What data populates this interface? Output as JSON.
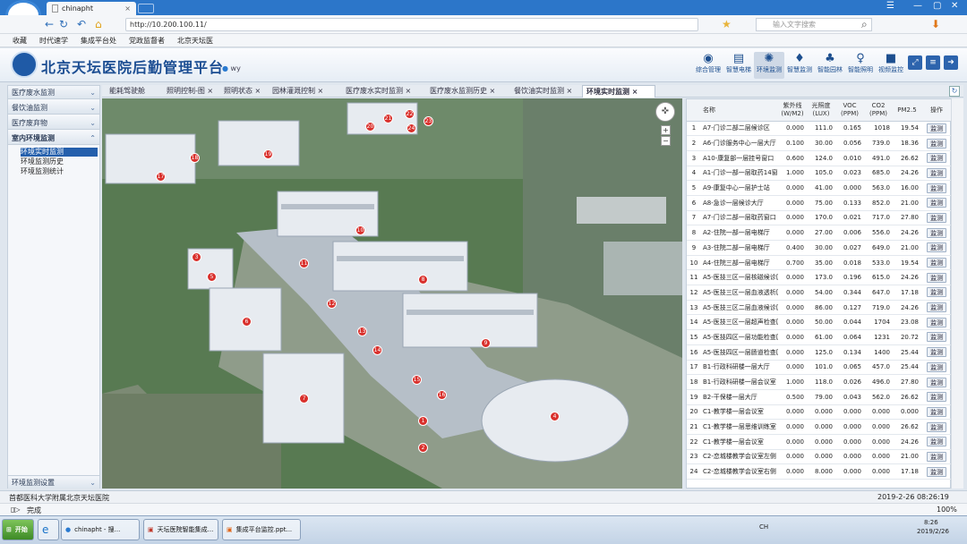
{
  "browser": {
    "tab_title": "chinapht",
    "tab_close": "×",
    "url": "http://10.200.100.11/",
    "search_placeholder": "输入文字搜索",
    "bookmarks": [
      "收藏",
      "时代速学",
      "集成平台处",
      "党政监督者",
      "北京天坛医"
    ],
    "status": "完成",
    "zoom": "100%"
  },
  "app": {
    "title": "北京天坛医院后勤管理平台",
    "user": "wy",
    "nav": [
      {
        "label": "综合管理",
        "icon": "eye-icon",
        "glyph": "◉"
      },
      {
        "label": "智慧电梯",
        "icon": "elevator-icon",
        "glyph": "▤"
      },
      {
        "label": "环境监测",
        "icon": "environment-icon",
        "glyph": "✺"
      },
      {
        "label": "智慧监测",
        "icon": "drop-icon",
        "glyph": "♦"
      },
      {
        "label": "智能园林",
        "icon": "tree-icon",
        "glyph": "♣"
      },
      {
        "label": "智能照明",
        "icon": "bulb-icon",
        "glyph": "♀"
      },
      {
        "label": "视频监控",
        "icon": "camera-icon",
        "glyph": "■"
      }
    ],
    "active_nav": 2
  },
  "sidebar": {
    "groups": [
      {
        "label": "医疗废水监测"
      },
      {
        "label": "餐饮油监测"
      },
      {
        "label": "医疗废弃物"
      },
      {
        "label": "室内环境监测"
      }
    ],
    "subitems": [
      "环境实时监测",
      "环境监测历史",
      "环境监测统计"
    ],
    "selected_sub": 0,
    "bottom": "环境监测设置"
  },
  "tabs": [
    "能耗驾驶舱",
    "照明控制-图 ×",
    "照明状态 ×",
    "园林灌溉控制 ×",
    "医疗废水实时监测 ×",
    "医疗废水监测历史 ×",
    "餐饮油实时监测 ×",
    "环境实时监测 ×"
  ],
  "active_tab": 7,
  "map_markers": [
    "1",
    "2",
    "3",
    "4",
    "5",
    "6",
    "7",
    "8",
    "9",
    "10",
    "11",
    "12",
    "13",
    "14",
    "15",
    "16",
    "17",
    "18",
    "19",
    "20",
    "21",
    "22",
    "23",
    "24"
  ],
  "table": {
    "headers": [
      "名称",
      "紫外线\n(W/M2)",
      "光照度\n(LUX)",
      "VOC\n(PPM)",
      "CO2\n(PPM)",
      "PM2.5",
      "操作"
    ],
    "action_label": "监测",
    "rows": [
      {
        "no": "1",
        "name": "A7-门诊二部二层候诊区",
        "uv": "0.000",
        "lux": "111.0",
        "voc": "0.165",
        "co2": "1018",
        "pm": "19.54"
      },
      {
        "no": "2",
        "name": "A6-门诊服务中心一层大厅",
        "uv": "0.100",
        "lux": "30.00",
        "voc": "0.056",
        "co2": "739.0",
        "pm": "18.36"
      },
      {
        "no": "3",
        "name": "A10-康复部一层挂号窗口",
        "uv": "0.600",
        "lux": "124.0",
        "voc": "0.010",
        "co2": "491.0",
        "pm": "26.62"
      },
      {
        "no": "4",
        "name": "A1-门诊一部一层取药14窗口",
        "uv": "1.000",
        "lux": "105.0",
        "voc": "0.023",
        "co2": "685.0",
        "pm": "24.26"
      },
      {
        "no": "5",
        "name": "A9-康复中心一层护士站",
        "uv": "0.000",
        "lux": "41.00",
        "voc": "0.000",
        "co2": "563.0",
        "pm": "16.00"
      },
      {
        "no": "6",
        "name": "A8-急诊一层候诊大厅",
        "uv": "0.000",
        "lux": "75.00",
        "voc": "0.133",
        "co2": "852.0",
        "pm": "21.00"
      },
      {
        "no": "7",
        "name": "A7-门诊二部一层取药窗口",
        "uv": "0.000",
        "lux": "170.0",
        "voc": "0.021",
        "co2": "717.0",
        "pm": "27.80"
      },
      {
        "no": "8",
        "name": "A2-住院一部一层电梯厅",
        "uv": "0.000",
        "lux": "27.00",
        "voc": "0.006",
        "co2": "556.0",
        "pm": "24.26"
      },
      {
        "no": "9",
        "name": "A3-住院二部一层电梯厅",
        "uv": "0.400",
        "lux": "30.00",
        "voc": "0.027",
        "co2": "649.0",
        "pm": "21.00"
      },
      {
        "no": "10",
        "name": "A4-住院三部一层电梯厅",
        "uv": "0.700",
        "lux": "35.00",
        "voc": "0.018",
        "co2": "533.0",
        "pm": "19.54"
      },
      {
        "no": "11",
        "name": "A5-医技三区一层核磁候诊区",
        "uv": "0.000",
        "lux": "173.0",
        "voc": "0.196",
        "co2": "615.0",
        "pm": "24.26"
      },
      {
        "no": "12",
        "name": "A5-医技三区一层血液透析区",
        "uv": "0.000",
        "lux": "54.00",
        "voc": "0.344",
        "co2": "647.0",
        "pm": "17.18"
      },
      {
        "no": "13",
        "name": "A5-医技三区二层血液候诊区",
        "uv": "0.000",
        "lux": "86.00",
        "voc": "0.127",
        "co2": "719.0",
        "pm": "24.26"
      },
      {
        "no": "14",
        "name": "A5-医技三区一层超声检查区",
        "uv": "0.000",
        "lux": "50.00",
        "voc": "0.044",
        "co2": "1704",
        "pm": "23.08"
      },
      {
        "no": "15",
        "name": "A5-医技四区一层功能检查区",
        "uv": "0.000",
        "lux": "61.00",
        "voc": "0.064",
        "co2": "1231",
        "pm": "20.72"
      },
      {
        "no": "16",
        "name": "A5-医技四区一层肠道检查区",
        "uv": "0.000",
        "lux": "125.0",
        "voc": "0.134",
        "co2": "1400",
        "pm": "25.44"
      },
      {
        "no": "17",
        "name": "B1-行政科研楼一层大厅",
        "uv": "0.000",
        "lux": "101.0",
        "voc": "0.065",
        "co2": "457.0",
        "pm": "25.44"
      },
      {
        "no": "18",
        "name": "B1-行政科研楼一层会议室",
        "uv": "1.000",
        "lux": "118.0",
        "voc": "0.026",
        "co2": "496.0",
        "pm": "27.80"
      },
      {
        "no": "19",
        "name": "B2-干保楼一层大厅",
        "uv": "0.500",
        "lux": "79.00",
        "voc": "0.043",
        "co2": "562.0",
        "pm": "26.62"
      },
      {
        "no": "20",
        "name": "C1-教学楼一层会议室",
        "uv": "0.000",
        "lux": "0.000",
        "voc": "0.000",
        "co2": "0.000",
        "pm": "0.000"
      },
      {
        "no": "21",
        "name": "C1-教学楼一层思维训练室",
        "uv": "0.000",
        "lux": "0.000",
        "voc": "0.000",
        "co2": "0.000",
        "pm": "26.62"
      },
      {
        "no": "22",
        "name": "C1-教学楼一层会议室",
        "uv": "0.000",
        "lux": "0.000",
        "voc": "0.000",
        "co2": "0.000",
        "pm": "24.26"
      },
      {
        "no": "23",
        "name": "C2-恋城楼教学会议室左侧",
        "uv": "0.000",
        "lux": "0.000",
        "voc": "0.000",
        "co2": "0.000",
        "pm": "21.00"
      },
      {
        "no": "24",
        "name": "C2-恋城楼教学会议室右侧",
        "uv": "0.000",
        "lux": "8.000",
        "voc": "0.000",
        "co2": "0.000",
        "pm": "17.18"
      }
    ]
  },
  "footer": {
    "left": "首都医科大学附属北京天坛医院",
    "right": "2019-2-26 08:26:19"
  },
  "taskbar": {
    "start": "开始",
    "items": [
      "chinapht - 搜...",
      "天坛医院智能集成...",
      "集成平台监控.ppt..."
    ],
    "time": "8:26",
    "date": "2019/2/26",
    "lang": "CH"
  }
}
